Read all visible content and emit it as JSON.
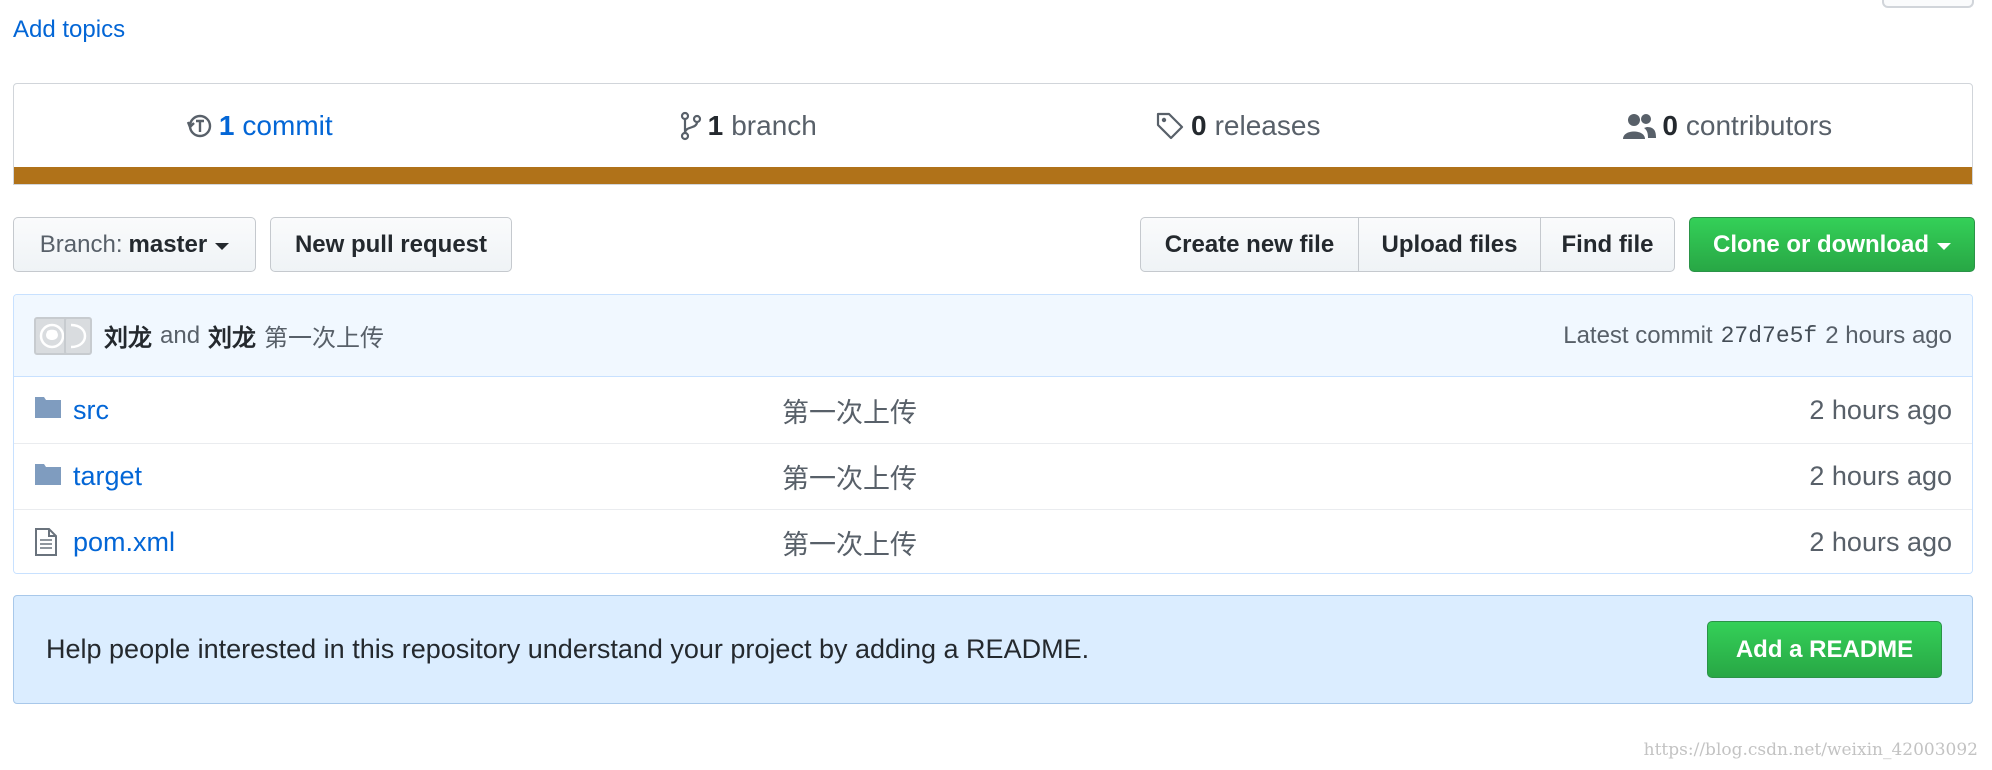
{
  "topics": {
    "add_label": "Add topics"
  },
  "summary": {
    "commits": {
      "count": "1",
      "label": "commit",
      "icon": "history-icon"
    },
    "branches": {
      "count": "1",
      "label": "branch",
      "icon": "git-branch-icon"
    },
    "releases": {
      "count": "0",
      "label": "releases",
      "icon": "tag-icon"
    },
    "contributors": {
      "count": "0",
      "label": "contributors",
      "icon": "people-icon"
    },
    "language_bar_color": "#b07219"
  },
  "toolbar": {
    "branch_prefix": "Branch:",
    "branch_name": "master",
    "new_pull_request": "New pull request",
    "create_new_file": "Create new file",
    "upload_files": "Upload files",
    "find_file": "Find file",
    "clone_or_download": "Clone or download"
  },
  "commit": {
    "author1": "刘龙",
    "and": "and",
    "author2": "刘龙",
    "message": "第一次上传",
    "latest_label": "Latest commit",
    "sha": "27d7e5f",
    "age": "2 hours ago"
  },
  "files": [
    {
      "type": "folder",
      "icon": "folder-icon",
      "name": "src",
      "message": "第一次上传",
      "age": "2 hours ago"
    },
    {
      "type": "folder",
      "icon": "folder-icon",
      "name": "target",
      "message": "第一次上传",
      "age": "2 hours ago"
    },
    {
      "type": "file",
      "icon": "file-icon",
      "name": "pom.xml",
      "message": "第一次上传",
      "age": "2 hours ago"
    }
  ],
  "readme": {
    "prompt": "Help people interested in this repository understand your project by adding a README.",
    "button": "Add a README"
  },
  "watermark": "https://blog.csdn.net/weixin_42003092",
  "colors": {
    "link": "#0366d6",
    "green_button": "#28a745",
    "commit_bg": "#f1f8ff",
    "readme_bg": "#dbedff"
  }
}
